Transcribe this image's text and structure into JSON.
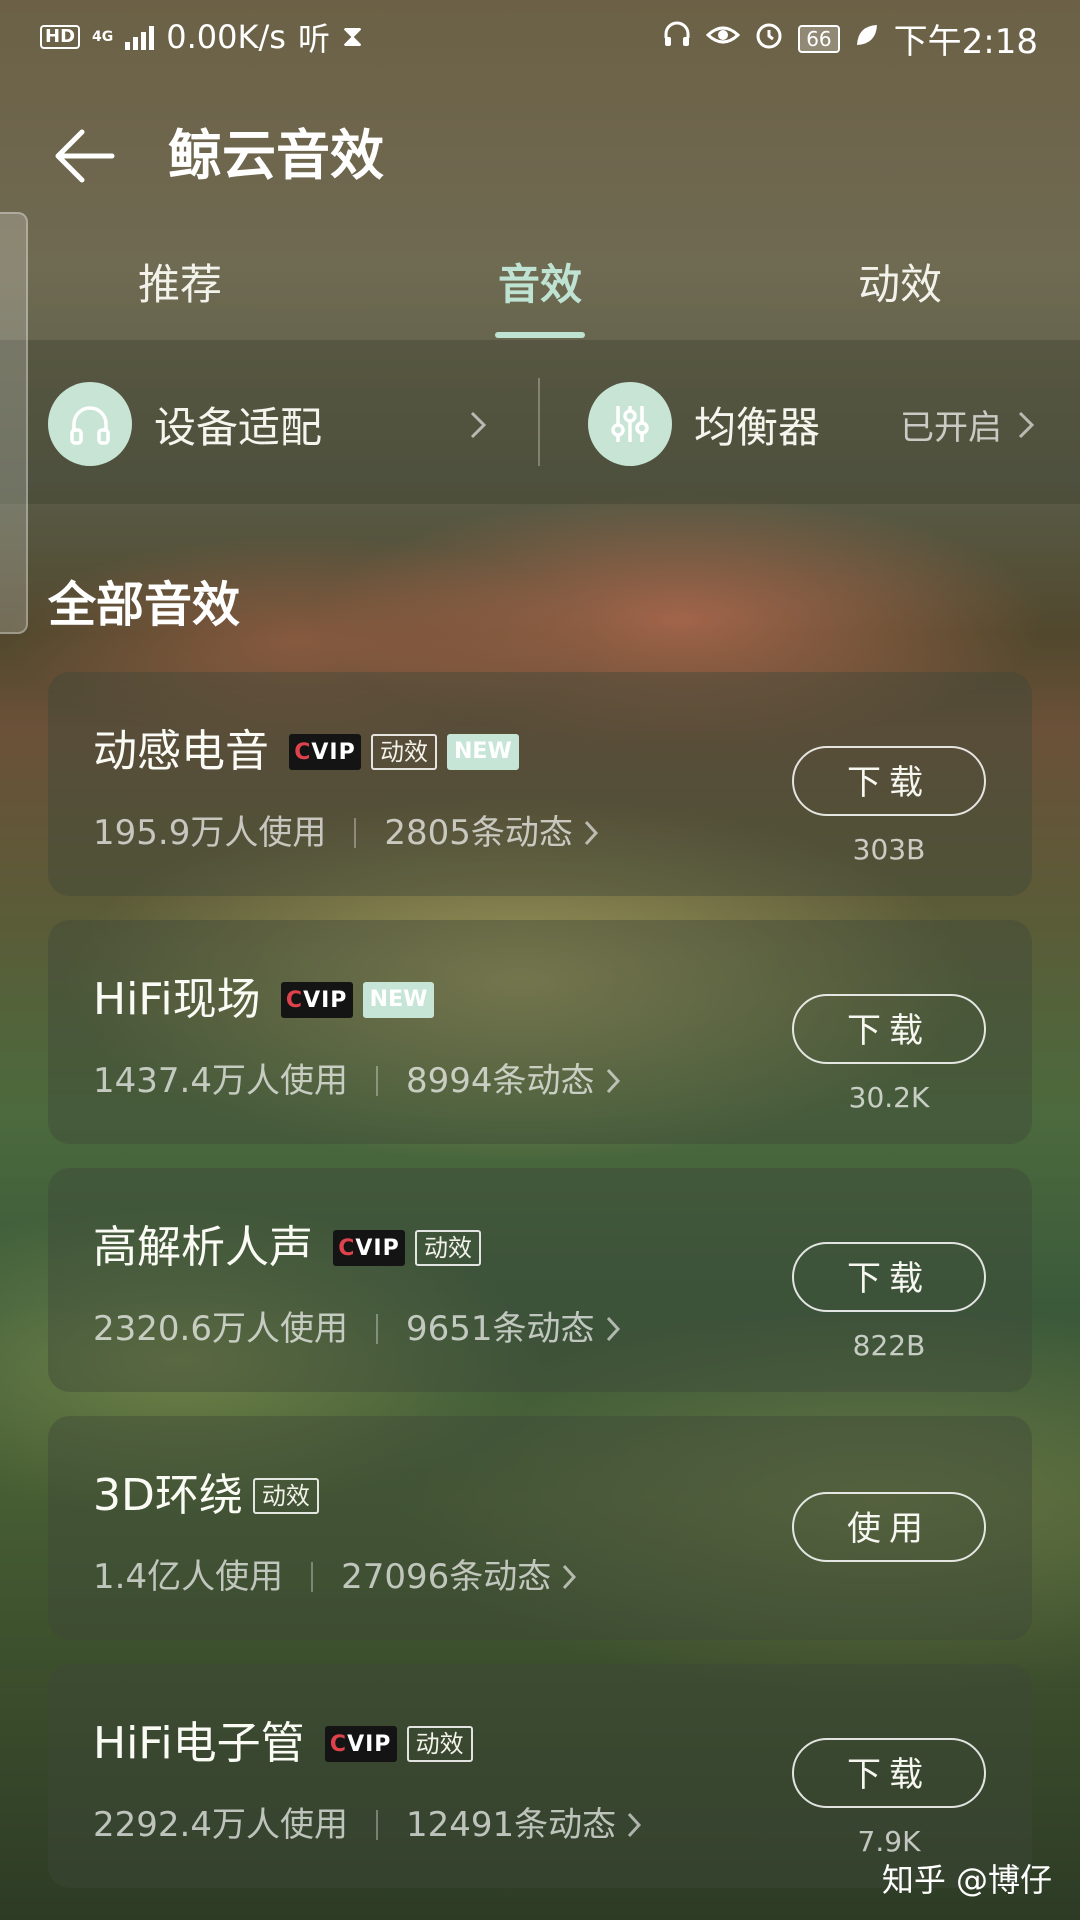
{
  "status_bar": {
    "hd": "HD",
    "network": "4G",
    "speed": "0.00K/s",
    "app_indicator": "听",
    "battery": "66",
    "time": "下午2:18"
  },
  "header": {
    "title": "鲸云音效"
  },
  "tabs": [
    {
      "label": "推荐",
      "active": false
    },
    {
      "label": "音效",
      "active": true
    },
    {
      "label": "动效",
      "active": false
    }
  ],
  "features": {
    "device": {
      "label": "设备适配",
      "icon": "headphones-icon"
    },
    "equalizer": {
      "label": "均衡器",
      "status": "已开启",
      "icon": "equalizer-icon"
    }
  },
  "section_title": "全部音效",
  "cards": [
    {
      "name": "动感电音",
      "vip": true,
      "vip_label": "VIP",
      "dynamic": true,
      "dynamic_label": "动效",
      "new": true,
      "new_label": "NEW",
      "users": "195.9万人使用",
      "posts": "2805条动态",
      "action": "下载",
      "size": "303B"
    },
    {
      "name": "HiFi现场",
      "vip": true,
      "vip_label": "VIP",
      "dynamic": false,
      "new": true,
      "new_label": "NEW",
      "users": "1437.4万人使用",
      "posts": "8994条动态",
      "action": "下载",
      "size": "30.2K"
    },
    {
      "name": "高解析人声",
      "vip": true,
      "vip_label": "VIP",
      "dynamic": true,
      "dynamic_label": "动效",
      "new": false,
      "users": "2320.6万人使用",
      "posts": "9651条动态",
      "action": "下载",
      "size": "822B"
    },
    {
      "name": "3D环绕",
      "vip": false,
      "dynamic": true,
      "dynamic_label": "动效",
      "new": false,
      "users": "1.4亿人使用",
      "posts": "27096条动态",
      "action": "使用",
      "size": ""
    },
    {
      "name": "HiFi电子管",
      "vip": true,
      "vip_label": "VIP",
      "dynamic": true,
      "dynamic_label": "动效",
      "new": false,
      "users": "2292.4万人使用",
      "posts": "12491条动态",
      "action": "下载",
      "size": "7.9K"
    }
  ],
  "watermark": "知乎 @博仔",
  "colors": {
    "accent": "#bfe3d2",
    "icon_bg": "#c8e4d5",
    "vip_red": "#e0424c"
  }
}
